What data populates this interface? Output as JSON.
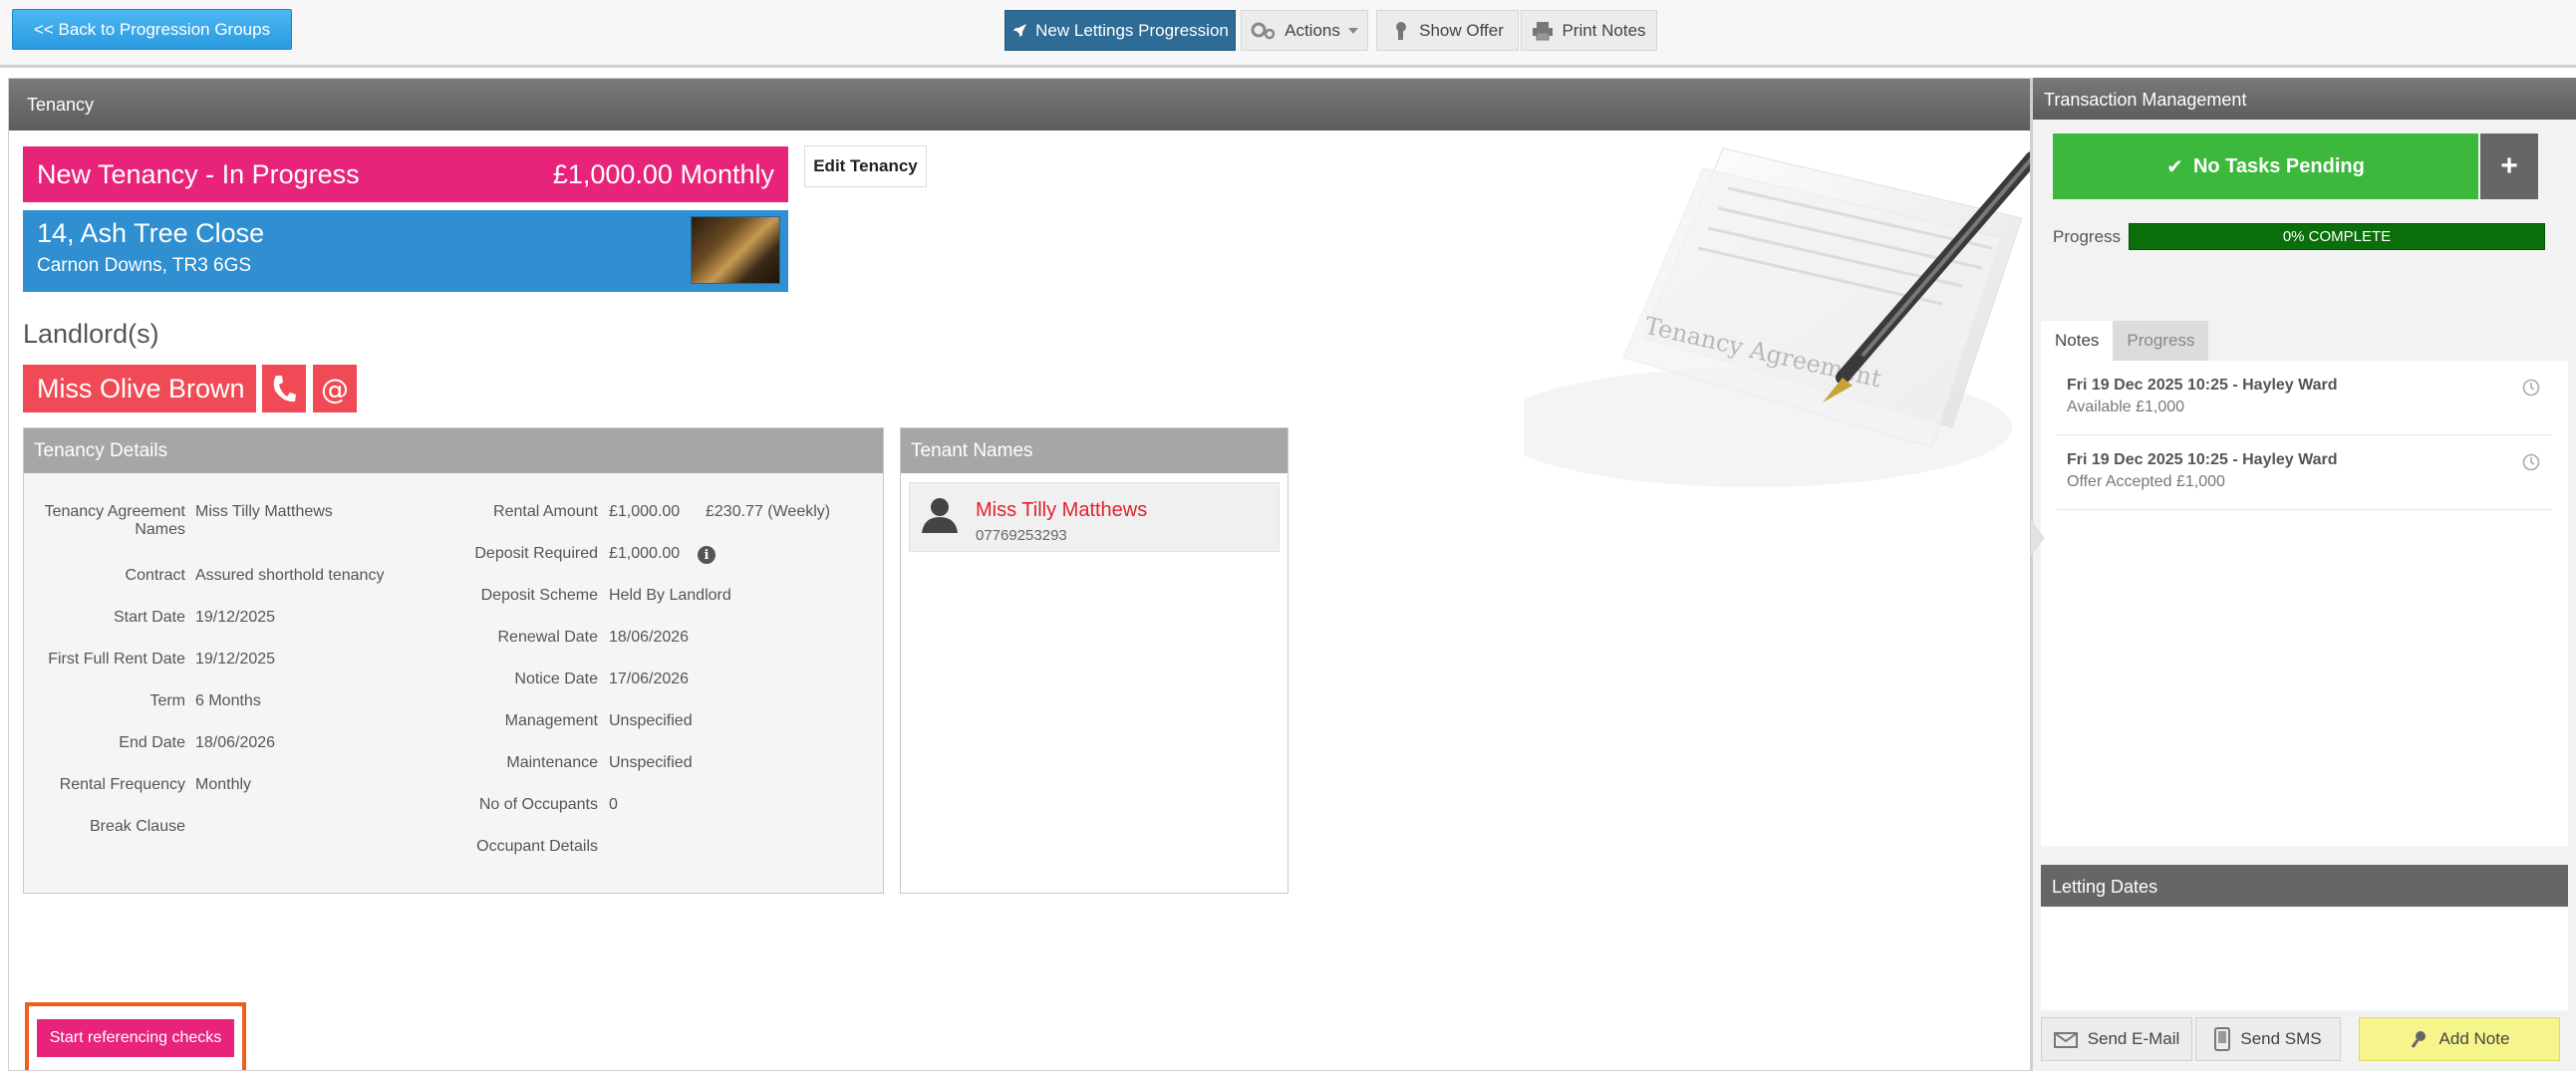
{
  "toolbar": {
    "back_label": "<< Back to Progression Groups",
    "new_progression_label": "New Lettings Progression",
    "actions_label": "Actions",
    "show_offer_label": "Show Offer",
    "print_notes_label": "Print Notes"
  },
  "tenancy": {
    "header": "Tenancy",
    "status": "New Tenancy - In Progress",
    "rent_summary": "£1,000.00 Monthly",
    "edit_label": "Edit Tenancy",
    "address_line1": "14, Ash Tree Close",
    "address_line2": "Carnon Downs, TR3 6GS",
    "graphic_text": "Tenancy Agreement"
  },
  "landlords": {
    "title": "Landlord(s)",
    "name": "Miss Olive Brown",
    "phone_icon": "phone-icon",
    "email_icon": "at-sign-icon"
  },
  "details": {
    "header": "Tenancy Details",
    "left": [
      {
        "label": "Tenancy Agreement Names",
        "value": "Miss Tilly Matthews"
      },
      {
        "label": "Contract",
        "value": "Assured shorthold tenancy"
      },
      {
        "label": "Start Date",
        "value": "19/12/2025"
      },
      {
        "label": "First Full Rent Date",
        "value": "19/12/2025"
      },
      {
        "label": "Term",
        "value": "6 Months"
      },
      {
        "label": "End Date",
        "value": "18/06/2026"
      },
      {
        "label": "Rental Frequency",
        "value": "Monthly"
      },
      {
        "label": "Break Clause",
        "value": ""
      }
    ],
    "right": [
      {
        "label": "Rental Amount",
        "value": "£1,000.00",
        "extra": "£230.77 (Weekly)"
      },
      {
        "label": "Deposit Required",
        "value": "£1,000.00"
      },
      {
        "label": "Deposit Scheme",
        "value": "Held By Landlord"
      },
      {
        "label": "Renewal Date",
        "value": "18/06/2026"
      },
      {
        "label": "Notice Date",
        "value": "17/06/2026"
      },
      {
        "label": "Management",
        "value": "Unspecified"
      },
      {
        "label": "Maintenance",
        "value": "Unspecified"
      },
      {
        "label": "No of Occupants",
        "value": "0"
      },
      {
        "label": "Occupant Details",
        "value": ""
      }
    ]
  },
  "tenants": {
    "header": "Tenant Names",
    "name": "Miss Tilly Matthews",
    "phone": "07769253293"
  },
  "actions": {
    "start_referencing_label": "Start referencing checks"
  },
  "transaction": {
    "header": "Transaction Management",
    "tasks_label": "No Tasks Pending",
    "add_label": "+",
    "progress_label": "Progress",
    "progress_text": "0% COMPLETE",
    "progress_value": 0,
    "tabs": [
      "Notes",
      "Progress"
    ],
    "notes": [
      {
        "title": "Fri 19 Dec 2025 10:25 - Hayley Ward",
        "detail": "Available £1,000"
      },
      {
        "title": "Fri 19 Dec 2025 10:25 - Hayley Ward",
        "detail": "Offer Accepted £1,000"
      }
    ],
    "letting_dates_header": "Letting Dates",
    "send_email_label": "Send E-Mail",
    "send_sms_label": "Send SMS",
    "add_note_label": "Add Note"
  },
  "colors": {
    "status_pink": "#e8237a",
    "address_blue": "#2f8fd0",
    "landlord_red": "#ef4a55",
    "tasks_green": "#3cb83c",
    "progress_dark_green": "#0a6e0a",
    "highlight_orange": "#f25a22"
  }
}
